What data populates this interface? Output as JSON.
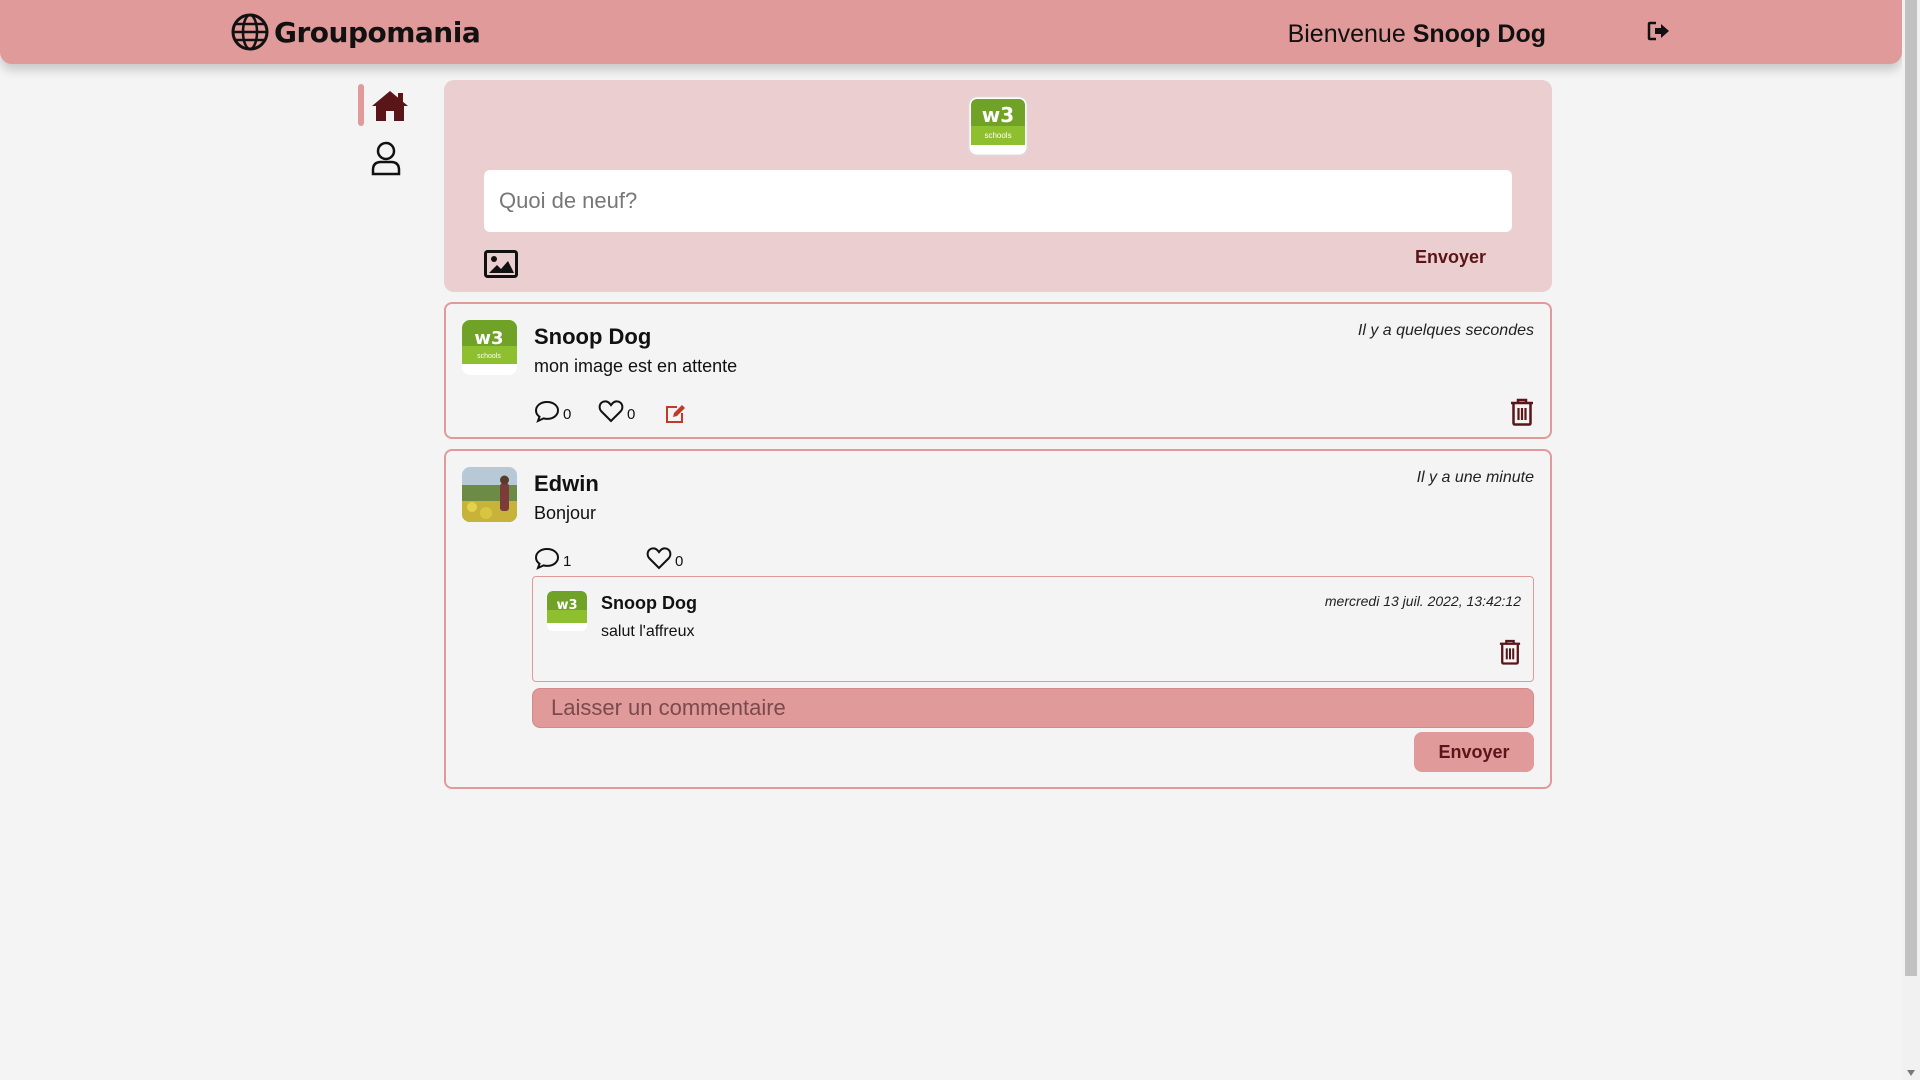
{
  "header": {
    "brand": "Groupomania",
    "welcome_prefix": "Bienvenue",
    "user_name": "Snoop Dog",
    "icons": {
      "brand": "globe-icon",
      "logout": "logout-icon"
    }
  },
  "nav": {
    "items": [
      {
        "name": "home",
        "icon": "home-icon",
        "active": true
      },
      {
        "name": "profile",
        "icon": "user-icon",
        "active": false
      }
    ]
  },
  "composer": {
    "placeholder": "Quoi de neuf?",
    "send_label": "Envoyer",
    "avatar_logo_text": "schools",
    "icons": {
      "image": "image-icon"
    }
  },
  "posts": [
    {
      "author": "Snoop Dog",
      "time": "Il y a quelques secondes",
      "text": "mon image est en attente",
      "comments_count": "0",
      "likes_count": "0",
      "editable": true,
      "deletable": true
    },
    {
      "author": "Edwin",
      "time": "Il y a une minute",
      "text": "Bonjour",
      "comments_count": "1",
      "likes_count": "0",
      "comments": [
        {
          "author": "Snoop Dog",
          "time": "mercredi 13 juil. 2022, 13:42:12",
          "text": "salut l'affreux"
        }
      ],
      "comment_placeholder": "Laisser un commentaire",
      "comment_send_label": "Envoyer"
    }
  ],
  "colors": {
    "header": "#e19a9a",
    "composer_bg": "#ebcfd0",
    "accent_dark": "#5a1518",
    "page_bg": "#f4f4f4"
  }
}
